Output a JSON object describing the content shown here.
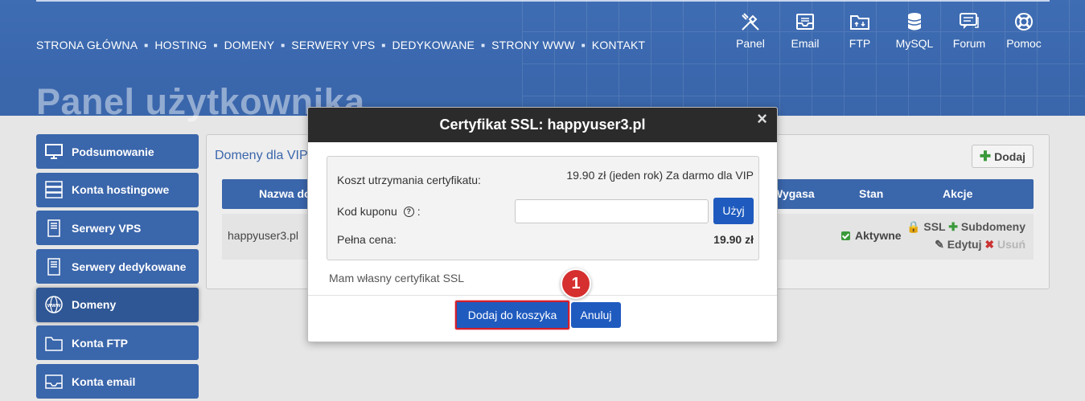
{
  "nav": {
    "items": [
      "STRONA GŁÓWNA",
      "HOSTING",
      "DOMENY",
      "SERWERY VPS",
      "DEDYKOWANE",
      "STRONY WWW",
      "KONTAKT"
    ]
  },
  "tools": [
    {
      "label": "Panel",
      "icon": "tools-icon"
    },
    {
      "label": "Email",
      "icon": "mail-icon"
    },
    {
      "label": "FTP",
      "icon": "folder-icon"
    },
    {
      "label": "MySQL",
      "icon": "database-icon"
    },
    {
      "label": "Forum",
      "icon": "chat-icon"
    },
    {
      "label": "Pomoc",
      "icon": "lifebuoy-icon"
    }
  ],
  "page_title": "Panel użytkownika",
  "sidebar": {
    "items": [
      {
        "label": "Podsumowanie",
        "icon": "monitor-icon"
      },
      {
        "label": "Konta hostingowe",
        "icon": "server-icon"
      },
      {
        "label": "Serwery VPS",
        "icon": "tower-icon"
      },
      {
        "label": "Serwery dedykowane",
        "icon": "tower-icon"
      },
      {
        "label": "Domeny",
        "icon": "www-globe-icon"
      },
      {
        "label": "Konta FTP",
        "icon": "folder-icon"
      },
      {
        "label": "Konta email",
        "icon": "mail-icon"
      }
    ]
  },
  "panel": {
    "title": "Domeny dla VIP",
    "add_label": "Dodaj",
    "columns": [
      "Nazwa do",
      "Wygasa",
      "Stan",
      "Akcje"
    ],
    "row": {
      "domain": "happyuser3.pl",
      "status": "Aktywne",
      "actions": {
        "ssl": "SSL",
        "subdomains": "Subdomeny",
        "edit": "Edytuj",
        "delete": "Usuń"
      }
    }
  },
  "modal": {
    "title": "Certyfikat SSL: happyuser3.pl",
    "close": "×",
    "cost_label": "Koszt utrzymania certyfikatu:",
    "cost_value": "19.90 zł (jeden rok) Za darmo dla VIP",
    "coupon_label": "Kod kuponu",
    "coupon_suffix": ":",
    "coupon_value": "",
    "use_label": "Użyj",
    "full_price_label": "Pełna cena:",
    "full_price_value": "19.90 zł",
    "own_ssl": "Mam własny certyfikat SSL",
    "add_to_cart": "Dodaj do koszyka",
    "cancel": "Anuluj"
  },
  "annotation": {
    "step": "1"
  },
  "colors": {
    "brand_blue": "#3a66ab",
    "button_blue": "#1f5bbf",
    "highlight_red": "#d11f2c"
  }
}
